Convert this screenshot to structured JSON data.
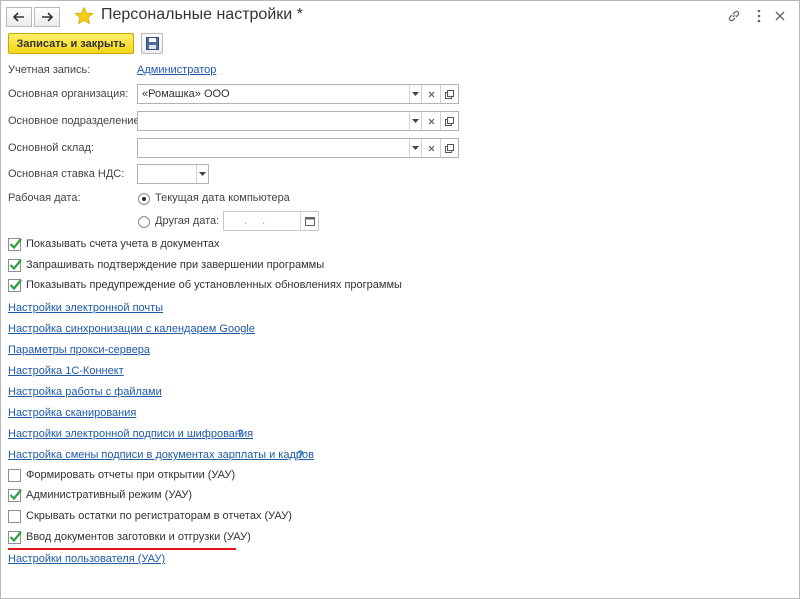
{
  "window": {
    "title": "Персональные настройки *"
  },
  "toolbar": {
    "save_close_label": "Записать и закрыть"
  },
  "form": {
    "account_label": "Учетная запись:",
    "account_value": "Администратор",
    "org_label": "Основная организация:",
    "org_value": "«Ромашка» ООО",
    "division_label": "Основное подразделение:",
    "division_value": "",
    "warehouse_label": "Основной склад:",
    "warehouse_value": "",
    "vat_label": "Основная ставка НДС:",
    "vat_value": "",
    "workdate_label": "Рабочая дата:",
    "workdate_option_current": "Текущая дата компьютера",
    "workdate_option_other": "Другая дата:",
    "workdate_other_mask": ". ."
  },
  "checks_top": [
    {
      "label": "Показывать счета учета в документах",
      "checked": true
    },
    {
      "label": "Запрашивать подтверждение при завершении программы",
      "checked": true
    },
    {
      "label": "Показывать предупреждение об установленных обновлениях программы",
      "checked": true
    }
  ],
  "links": [
    "Настройки электронной почты",
    "Настройка синхронизации с календарем Google",
    "Параметры прокси-сервера",
    "Настройка 1С-Коннект",
    "Настройка работы с файлами",
    "Настройка сканирования",
    "Настройки электронной подписи и шифрования",
    "Настройка смены подписи в документах зарплаты и кадров"
  ],
  "help_mark": "?",
  "checks_bottom": [
    {
      "label": "Формировать отчеты при открытии (УАУ)",
      "checked": false
    },
    {
      "label": "Административный режим (УАУ)",
      "checked": true
    },
    {
      "label": "Скрывать остатки по регистраторам в отчетах (УАУ)",
      "checked": false
    },
    {
      "label": "Ввод документов заготовки и отгрузки (УАУ)",
      "checked": true
    }
  ],
  "user_settings_link": "Настройки пользователя (УАУ)",
  "colors": {
    "accent_yellow": "#f3d617",
    "link_blue": "#1f5aa8",
    "highlight_red": "#e0181b",
    "check_green": "#2e9e3e"
  }
}
